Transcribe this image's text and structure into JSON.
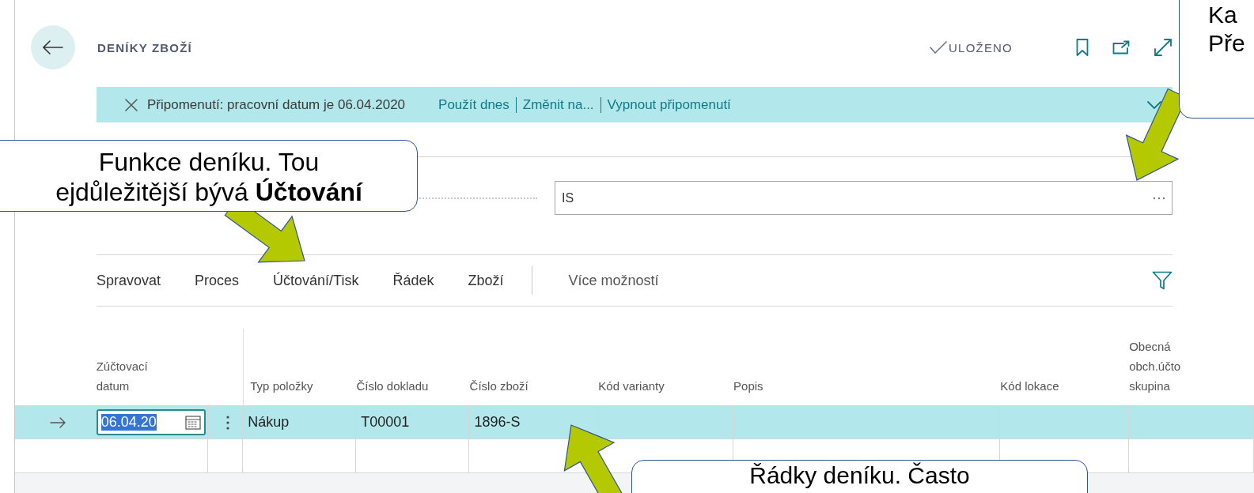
{
  "header": {
    "title": "DENÍKY ZBOŽÍ",
    "status": "ULOŽENO"
  },
  "notification": {
    "message": "Připomenutí: pracovní datum je 06.04.2020",
    "links": [
      "Použít dnes",
      "Změnit na...",
      "Vypnout připomenutí"
    ]
  },
  "batch_field": {
    "value": "IS"
  },
  "actions": {
    "items": [
      "Spravovat",
      "Proces",
      "Účtování/Tisk",
      "Řádek",
      "Zboží"
    ],
    "more": "Více možností"
  },
  "table": {
    "columns": [
      "Zúčtovací datum",
      "",
      "Typ položky",
      "Číslo dokladu",
      "Číslo zboží",
      "Kód varianty",
      "Popis",
      "Kód lokace",
      "Obecná obch.účto skupina"
    ],
    "rows": [
      {
        "selected": true,
        "cells": [
          "06.04.20",
          "",
          "Nákup",
          "T00001",
          "1896-S"
        ]
      },
      {
        "selected": false,
        "cells": []
      }
    ]
  },
  "callouts": [
    {
      "text": "Funkce deníku. Tou\nejdůležitější bývá **Účtování**"
    },
    {
      "text": "Ka\nPře"
    },
    {
      "text": "Řádky deníku. Často"
    }
  ]
}
